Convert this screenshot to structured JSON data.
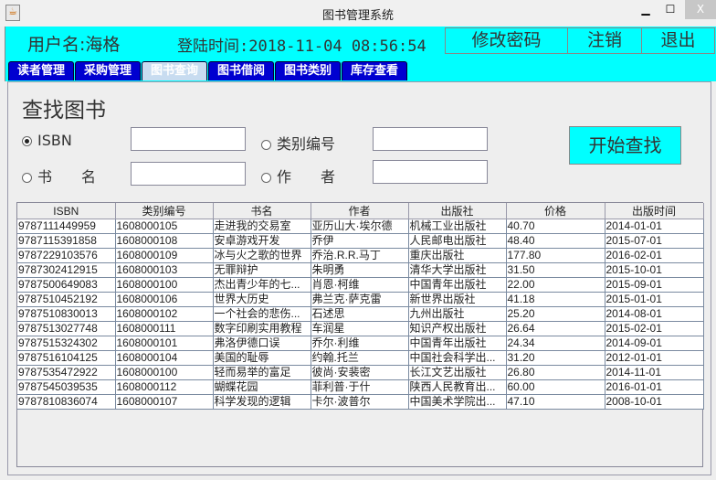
{
  "window": {
    "title": "图书管理系统",
    "minimize": "▁",
    "maximize": "☐",
    "close": "X"
  },
  "header": {
    "username_label": "用户名:海格",
    "login_time": "登陆时间:2018-11-04 08:56:54",
    "change_password": "修改密码",
    "logout": "注销",
    "exit": "退出"
  },
  "tabs": [
    "读者管理",
    "采购管理",
    "图书查询",
    "图书借阅",
    "图书类别",
    "库存查看"
  ],
  "active_tab": 2,
  "search": {
    "title": "查找图书",
    "isbn_label": "ISBN",
    "category_label": "类别编号",
    "name_label": "书　　名",
    "author_label": "作　　者",
    "isbn_value": "",
    "category_value": "",
    "name_value": "",
    "author_value": "",
    "selected": "ISBN",
    "button": "开始查找"
  },
  "table": {
    "columns": [
      "ISBN",
      "类别编号",
      "书名",
      "作者",
      "出版社",
      "价格",
      "出版时间"
    ],
    "rows": [
      [
        "9787111449959",
        "1608000105",
        "走进我的交易室",
        "亚历山大·埃尔德",
        "机械工业出版社",
        "40.70",
        "2014-01-01"
      ],
      [
        "9787115391858",
        "1608000108",
        "安卓游戏开发",
        "乔伊",
        "人民邮电出版社",
        "48.40",
        "2015-07-01"
      ],
      [
        "9787229103576",
        "1608000109",
        "冰与火之歌的世界",
        "乔治.R.R.马丁",
        "重庆出版社",
        "177.80",
        "2016-02-01"
      ],
      [
        "9787302412915",
        "1608000103",
        "无罪辩护",
        "朱明勇",
        "清华大学出版社",
        "31.50",
        "2015-10-01"
      ],
      [
        "9787500649083",
        "1608000100",
        "杰出青少年的七...",
        "肖恩·柯维",
        "中国青年出版社",
        "22.00",
        "2015-09-01"
      ],
      [
        "9787510452192",
        "1608000106",
        "世界大历史",
        "弗兰克·萨克雷",
        "新世界出版社",
        "41.18",
        "2015-01-01"
      ],
      [
        "9787510830013",
        "1608000102",
        "一个社会的悲伤...",
        "石述思",
        "九州出版社",
        "25.20",
        "2014-08-01"
      ],
      [
        "9787513027748",
        "1608000111",
        "数字印刷实用教程",
        "车润星",
        "知识产权出版社",
        "26.64",
        "2015-02-01"
      ],
      [
        "9787515324302",
        "1608000101",
        "弗洛伊德口误",
        "乔尔·利维",
        "中国青年出版社",
        "24.34",
        "2014-09-01"
      ],
      [
        "9787516104125",
        "1608000104",
        "美国的耻辱",
        "约翰.托兰",
        "中国社会科学出...",
        "31.20",
        "2012-01-01"
      ],
      [
        "9787535472922",
        "1608000100",
        "轻而易举的富足",
        "彼尚·安裴密",
        "长江文艺出版社",
        "26.80",
        "2014-11-01"
      ],
      [
        "9787545039535",
        "1608000112",
        "蝴蝶花园",
        "菲利普·于什",
        "陕西人民教育出...",
        "60.00",
        "2016-01-01"
      ],
      [
        "9787810836074",
        "1608000107",
        "科学发现的逻辑",
        "卡尔·波普尔",
        "中国美术学院出...",
        "47.10",
        "2008-10-01"
      ]
    ]
  }
}
